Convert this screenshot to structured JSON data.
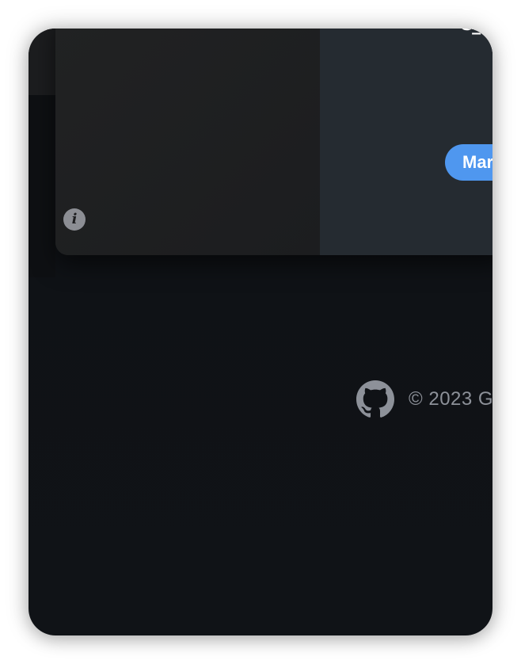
{
  "card": {
    "info_icon_glyph": "i",
    "corner_glyph": "C_",
    "primary_button_label": "Mar"
  },
  "footer": {
    "icon": "github-icon",
    "copyright": "© 2023 G"
  },
  "colors": {
    "accent": "#4f97ef",
    "background": "#101317",
    "card_left": "#1d1e20",
    "card_right": "#252b31",
    "muted_text": "#8d9199"
  }
}
